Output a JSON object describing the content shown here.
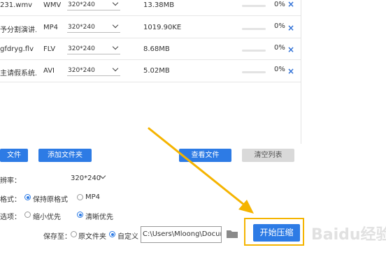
{
  "files": [
    {
      "name": "231.wmv",
      "format": "WMV",
      "resolution": "320*240",
      "size": "13.38MB",
      "percent": "0%",
      "progress": 0
    },
    {
      "name": "予分割演讲...",
      "format": "MP4",
      "resolution": "320*240",
      "size": "1019.90KE",
      "percent": "0%",
      "progress": 0
    },
    {
      "name": "gfdryg.flv",
      "format": "FLV",
      "resolution": "320*240",
      "size": "8.68MB",
      "percent": "0%",
      "progress": 0
    },
    {
      "name": "主请假系统...",
      "format": "AVI",
      "resolution": "320*240",
      "size": "5.02MB",
      "percent": "0%",
      "progress": 0
    }
  ],
  "remove_glyph": "×",
  "toolbar": {
    "add_file": "文件",
    "add_folder": "添加文件夹",
    "view_files": "查看文件",
    "clear_list": "清空列表"
  },
  "settings": {
    "resolution_label": "辨率：",
    "resolution_value": "320*240",
    "format_label": "格式：",
    "format_keep": "保持原格式",
    "format_mp4": "MP4",
    "option_label": "选项：",
    "option_small": "缩小优先",
    "option_clear": "清晰优先"
  },
  "save": {
    "label": "保存至：",
    "original_folder": "原文件夹",
    "custom": "自定义",
    "path": "C:\\Users\\Mloong\\Docume"
  },
  "start_button": "开始压缩",
  "watermark": "Baidu经验",
  "colors": {
    "accent": "#2d7be5",
    "highlight": "#f5b400"
  },
  "icons": [
    "folder-icon",
    "chevron-down-icon",
    "close-icon",
    "arrow-annotation-icon"
  ]
}
